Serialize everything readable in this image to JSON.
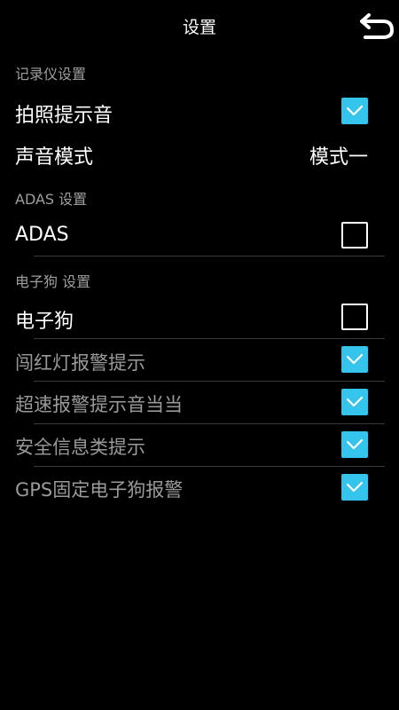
{
  "header": {
    "title": "设置",
    "back_icon": "back-arrow-icon"
  },
  "sections": {
    "recorder": {
      "label": "记录仪设置"
    },
    "adas": {
      "label": "ADAS 设置"
    },
    "edog": {
      "label": "电子狗 设置"
    }
  },
  "rows": {
    "shutter_sound": {
      "label": "拍照提示音",
      "checked": true
    },
    "sound_mode": {
      "label": "声音模式",
      "value": "模式一"
    },
    "adas": {
      "label": "ADAS",
      "checked": false
    },
    "edog": {
      "label": "电子狗",
      "checked": false
    },
    "red_light": {
      "label": "闯红灯报警提示",
      "checked": true
    },
    "overspeed": {
      "label": "超速报警提示音当当",
      "checked": true
    },
    "safety_info": {
      "label": "安全信息类提示",
      "checked": true
    },
    "gps_fixed": {
      "label": "GPS固定电子狗报警",
      "checked": true
    }
  },
  "colors": {
    "accent": "#35c4ec",
    "background": "#000000",
    "section_text": "#9e9e9e",
    "disabled_text": "#9a9a9a"
  }
}
